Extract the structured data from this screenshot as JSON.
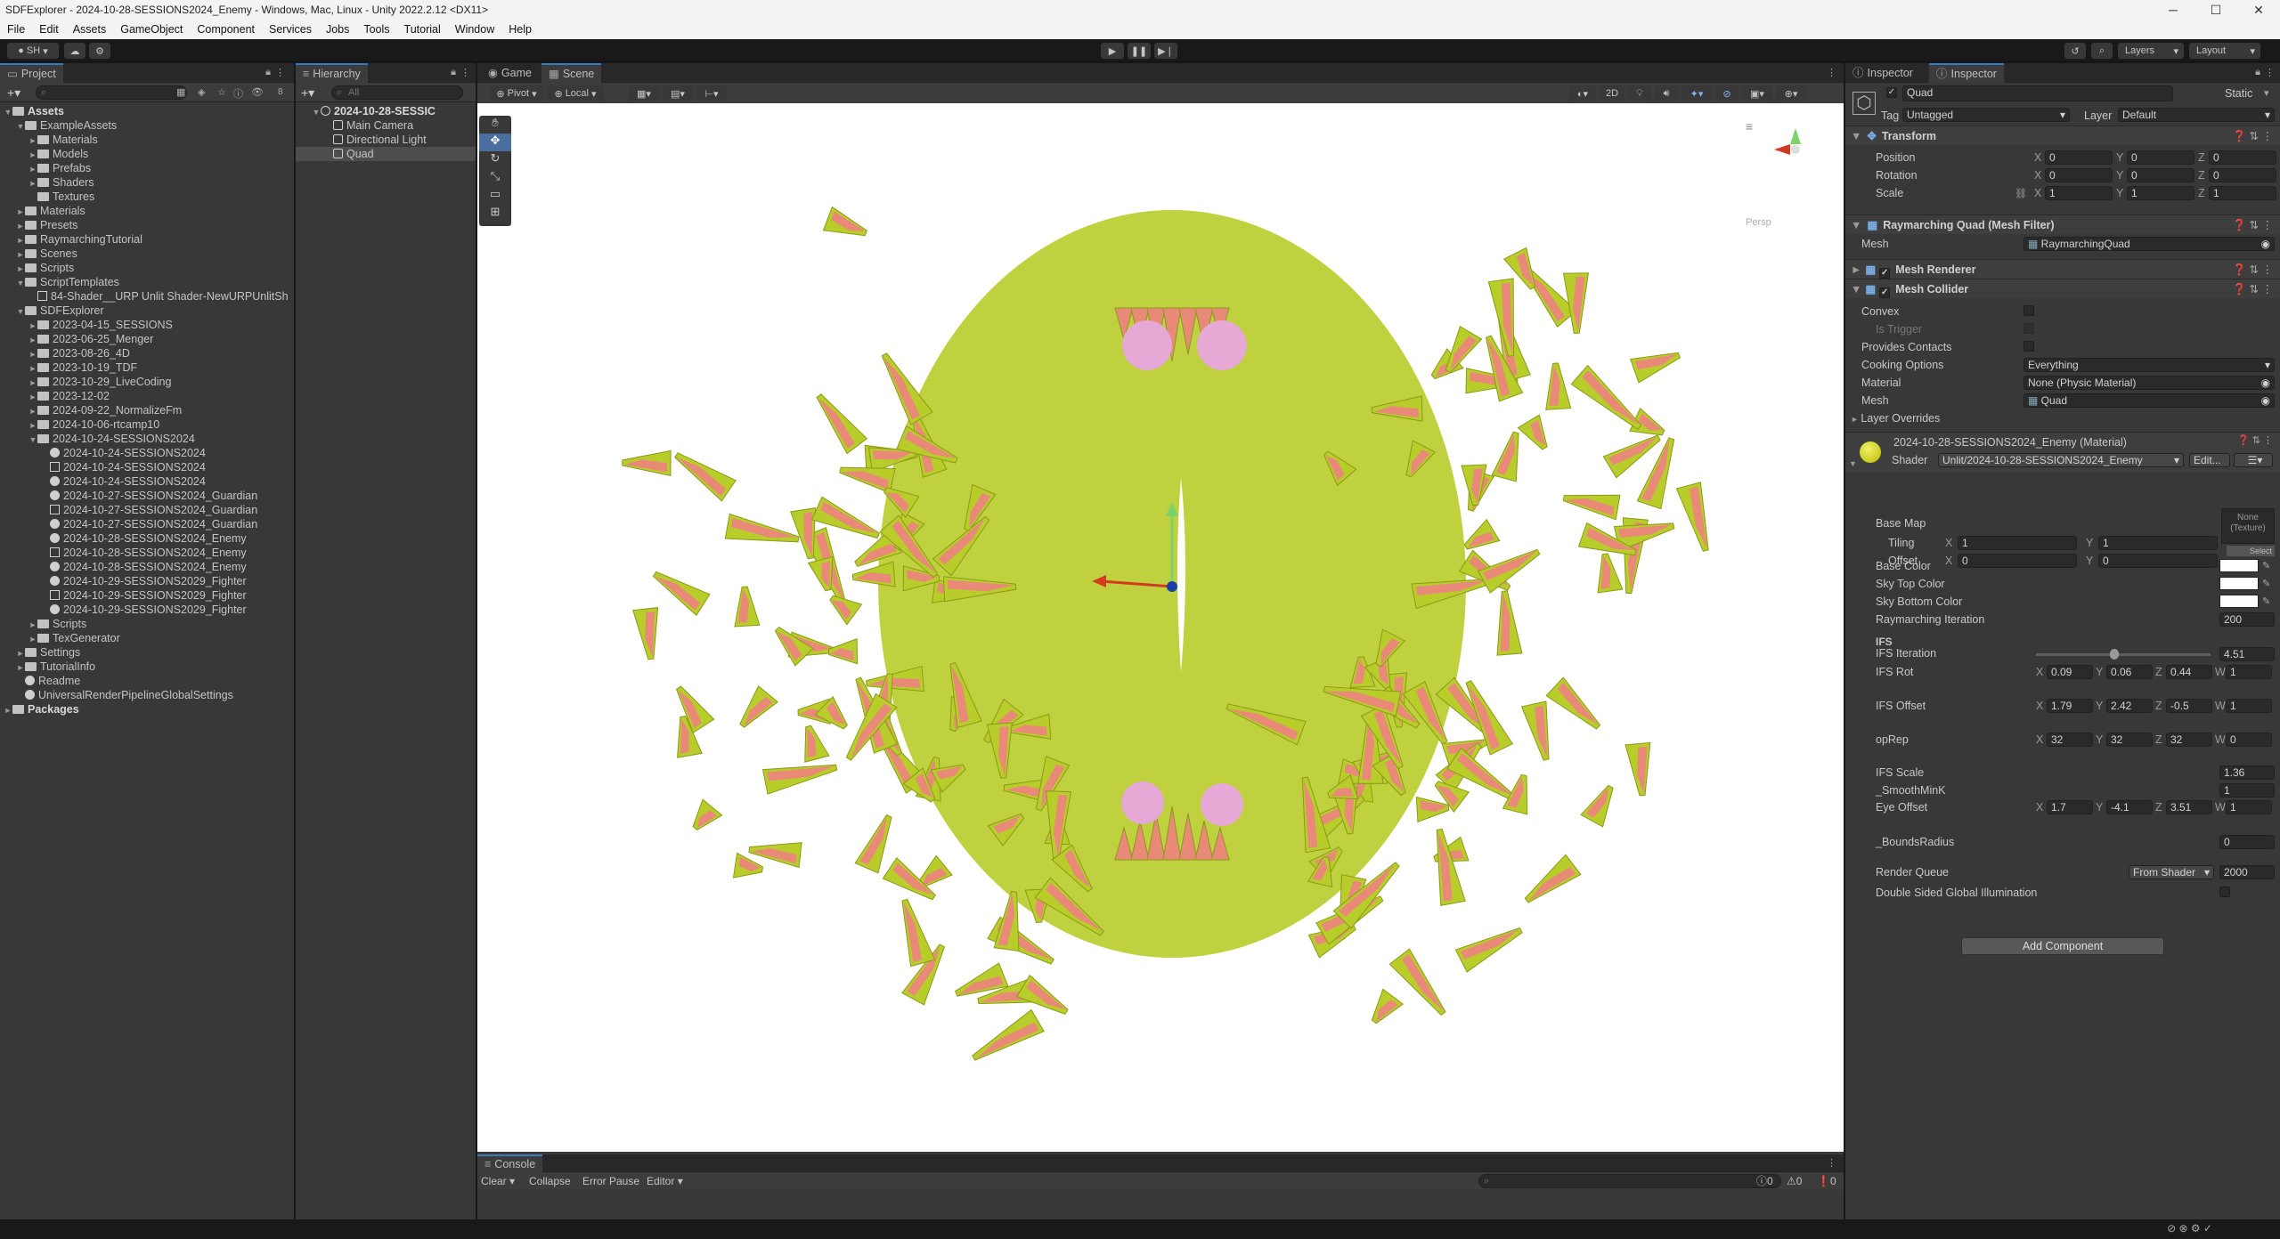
{
  "window": {
    "title": "SDFExplorer - 2024-10-28-SESSIONS2024_Enemy - Windows, Mac, Linux - Unity 2022.2.12 <DX11>"
  },
  "menu": [
    "File",
    "Edit",
    "Assets",
    "GameObject",
    "Component",
    "Services",
    "Jobs",
    "Tools",
    "Tutorial",
    "Window",
    "Help"
  ],
  "toolbar": {
    "account": "SH",
    "layers": "Layers",
    "layout": "Layout"
  },
  "project": {
    "tab": "Project",
    "count": "8",
    "items": [
      {
        "label": "Assets",
        "d": 0,
        "t": "f",
        "ar": "▼",
        "b": true
      },
      {
        "label": "ExampleAssets",
        "d": 1,
        "t": "f",
        "ar": "▼"
      },
      {
        "label": "Materials",
        "d": 2,
        "t": "f",
        "ar": "►"
      },
      {
        "label": "Models",
        "d": 2,
        "t": "f",
        "ar": "►"
      },
      {
        "label": "Prefabs",
        "d": 2,
        "t": "f",
        "ar": "►"
      },
      {
        "label": "Shaders",
        "d": 2,
        "t": "f",
        "ar": "►"
      },
      {
        "label": "Textures",
        "d": 2,
        "t": "f",
        "ar": ""
      },
      {
        "label": "Materials",
        "d": 1,
        "t": "f",
        "ar": "►"
      },
      {
        "label": "Presets",
        "d": 1,
        "t": "f",
        "ar": "►"
      },
      {
        "label": "RaymarchingTutorial",
        "d": 1,
        "t": "f",
        "ar": "►"
      },
      {
        "label": "Scenes",
        "d": 1,
        "t": "f",
        "ar": "►"
      },
      {
        "label": "Scripts",
        "d": 1,
        "t": "f",
        "ar": "►"
      },
      {
        "label": "ScriptTemplates",
        "d": 1,
        "t": "f",
        "ar": "▼"
      },
      {
        "label": "84-Shader__URP Unlit Shader-NewURPUnlitSh",
        "d": 2,
        "t": "g",
        "ar": ""
      },
      {
        "label": "SDFExplorer",
        "d": 1,
        "t": "f",
        "ar": "▼"
      },
      {
        "label": "2023-04-15_SESSIONS",
        "d": 2,
        "t": "f",
        "ar": "►"
      },
      {
        "label": "2023-06-25_Menger",
        "d": 2,
        "t": "f",
        "ar": "►"
      },
      {
        "label": "2023-08-26_4D",
        "d": 2,
        "t": "f",
        "ar": "►"
      },
      {
        "label": "2023-10-19_TDF",
        "d": 2,
        "t": "f",
        "ar": "►"
      },
      {
        "label": "2023-10-29_LiveCoding",
        "d": 2,
        "t": "f",
        "ar": "►"
      },
      {
        "label": "2023-12-02",
        "d": 2,
        "t": "f",
        "ar": "►"
      },
      {
        "label": "2024-09-22_NormalizeFm",
        "d": 2,
        "t": "f",
        "ar": "►"
      },
      {
        "label": "2024-10-06-rtcamp10",
        "d": 2,
        "t": "f",
        "ar": "►"
      },
      {
        "label": "2024-10-24-SESSIONS2024",
        "d": 2,
        "t": "f",
        "ar": "▼"
      },
      {
        "label": "2024-10-24-SESSIONS2024",
        "d": 3,
        "t": "a",
        "ar": ""
      },
      {
        "label": "2024-10-24-SESSIONS2024",
        "d": 3,
        "t": "g",
        "ar": ""
      },
      {
        "label": "2024-10-24-SESSIONS2024",
        "d": 3,
        "t": "a",
        "ar": ""
      },
      {
        "label": "2024-10-27-SESSIONS2024_Guardian",
        "d": 3,
        "t": "a",
        "ar": ""
      },
      {
        "label": "2024-10-27-SESSIONS2024_Guardian",
        "d": 3,
        "t": "g",
        "ar": ""
      },
      {
        "label": "2024-10-27-SESSIONS2024_Guardian",
        "d": 3,
        "t": "a",
        "ar": ""
      },
      {
        "label": "2024-10-28-SESSIONS2024_Enemy",
        "d": 3,
        "t": "a",
        "ar": ""
      },
      {
        "label": "2024-10-28-SESSIONS2024_Enemy",
        "d": 3,
        "t": "g",
        "ar": ""
      },
      {
        "label": "2024-10-28-SESSIONS2024_Enemy",
        "d": 3,
        "t": "a",
        "ar": ""
      },
      {
        "label": "2024-10-29-SESSIONS2029_Fighter",
        "d": 3,
        "t": "a",
        "ar": ""
      },
      {
        "label": "2024-10-29-SESSIONS2029_Fighter",
        "d": 3,
        "t": "g",
        "ar": ""
      },
      {
        "label": "2024-10-29-SESSIONS2029_Fighter",
        "d": 3,
        "t": "a",
        "ar": ""
      },
      {
        "label": "Scripts",
        "d": 2,
        "t": "f",
        "ar": "►"
      },
      {
        "label": "TexGenerator",
        "d": 2,
        "t": "f",
        "ar": "►"
      },
      {
        "label": "Settings",
        "d": 1,
        "t": "f",
        "ar": "►"
      },
      {
        "label": "TutorialInfo",
        "d": 1,
        "t": "f",
        "ar": "►"
      },
      {
        "label": "Readme",
        "d": 1,
        "t": "a",
        "ar": ""
      },
      {
        "label": "UniversalRenderPipelineGlobalSettings",
        "d": 1,
        "t": "a",
        "ar": ""
      },
      {
        "label": "Packages",
        "d": 0,
        "t": "f",
        "ar": "►",
        "b": true
      }
    ]
  },
  "hierarchy": {
    "tab": "Hierarchy",
    "search_placeholder": "All",
    "items": [
      {
        "label": "2024-10-28-SESSIC",
        "d": 0,
        "b": true,
        "ar": "▼"
      },
      {
        "label": "Main Camera",
        "d": 1,
        "ar": ""
      },
      {
        "label": "Directional Light",
        "d": 1,
        "ar": ""
      },
      {
        "label": "Quad",
        "d": 1,
        "ar": "",
        "sel": true
      }
    ]
  },
  "scene": {
    "tabs": [
      "Game",
      "Scene"
    ],
    "pivot": "Pivot",
    "local": "Local",
    "mode2d": "2D",
    "persp": "Persp"
  },
  "console": {
    "tab": "Console",
    "clear": "Clear",
    "collapse": "Collapse",
    "error_pause": "Error Pause",
    "editor": "Editor",
    "counts": [
      "0",
      "0",
      "0"
    ]
  },
  "inspector": {
    "tabs": [
      "Inspector",
      "Inspector"
    ],
    "name": "Quad",
    "static": "Static",
    "tag_label": "Tag",
    "tag": "Untagged",
    "layer_label": "Layer",
    "layer": "Default",
    "transform": {
      "title": "Transform",
      "rows": [
        {
          "label": "Position",
          "x": "0",
          "y": "0",
          "z": "0"
        },
        {
          "label": "Rotation",
          "x": "0",
          "y": "0",
          "z": "0"
        },
        {
          "label": "Scale",
          "x": "1",
          "y": "1",
          "z": "1"
        }
      ]
    },
    "meshfilter": {
      "title": "Raymarching Quad (Mesh Filter)",
      "mesh_label": "Mesh",
      "mesh": "RaymarchingQuad"
    },
    "meshrenderer": {
      "title": "Mesh Renderer"
    },
    "meshcollider": {
      "title": "Mesh Collider",
      "convex": "Convex",
      "is_trigger": "Is Trigger",
      "provides": "Provides Contacts",
      "cooking_label": "Cooking Options",
      "cooking": "Everything",
      "material_label": "Material",
      "material": "None (Physic Material)",
      "mesh_label": "Mesh",
      "mesh": "Quad"
    },
    "layer_overrides": "Layer Overrides",
    "material": {
      "title": "2024-10-28-SESSIONS2024_Enemy (Material)",
      "shader_label": "Shader",
      "shader": "Unlit/2024-10-28-SESSIONS2024_Enemy",
      "edit": "Edit...",
      "base_map": "Base Map",
      "none_texture": "None\n(Texture)",
      "select": "Select",
      "tiling": "Tiling",
      "tx": "1",
      "ty": "1",
      "offset": "Offset",
      "ox": "0",
      "oy": "0",
      "base_color": "Base Color",
      "sky_top": "Sky Top Color",
      "sky_bottom": "Sky Bottom Color",
      "ray_iter": "Raymarching Iteration",
      "ray_iter_val": "200",
      "ifs_header": "IFS",
      "ifs_iter": "IFS Iteration",
      "ifs_iter_val": "4.51",
      "ifs_iter_frac": 0.45,
      "vec4": [
        {
          "label": "IFS Rot",
          "x": "0.09",
          "y": "0.06",
          "z": "0.44",
          "w": "1"
        },
        {
          "label": "IFS Offset",
          "x": "1.79",
          "y": "2.42",
          "z": "-0.5",
          "w": "1"
        },
        {
          "label": "opRep",
          "x": "32",
          "y": "32",
          "z": "32",
          "w": "0"
        }
      ],
      "ifs_scale": "IFS Scale",
      "ifs_scale_val": "1.36",
      "smooth": "_SmoothMinK",
      "smooth_val": "1",
      "eye": {
        "label": "Eye Offset",
        "x": "1.7",
        "y": "-4.1",
        "z": "3.51",
        "w": "1"
      },
      "bounds": "_BoundsRadius",
      "bounds_val": "0",
      "render_queue": "Render Queue",
      "rq_mode": "From Shader",
      "rq_val": "2000",
      "double_sided": "Double Sided Global Illumination"
    },
    "add_component": "Add Component"
  },
  "colors": {
    "accent": "#3a79bb",
    "shape_yellow": "#b8cc2a",
    "shape_pink": "#e98a78",
    "eye": "#e6a8d4"
  }
}
